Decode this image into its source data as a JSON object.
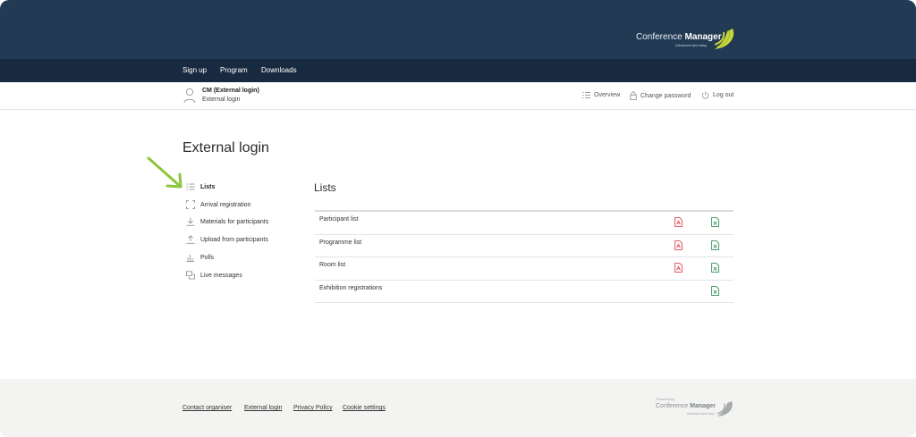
{
  "brand": {
    "name_light": "Conference ",
    "name_bold": "Manager",
    "tagline": "Advanced and easy",
    "logo_color": "#c7d63b"
  },
  "nav": {
    "items": [
      {
        "label": "Sign up"
      },
      {
        "label": "Program"
      },
      {
        "label": "Downloads"
      }
    ]
  },
  "user": {
    "name": "CM (External login)",
    "subtitle": "External login",
    "links": {
      "overview": "Overview",
      "change_password": "Change password",
      "logout": "Log out"
    }
  },
  "page": {
    "title": "External login"
  },
  "sidebar": {
    "items": [
      {
        "label": "Lists",
        "icon": "list-icon",
        "active": true
      },
      {
        "label": "Arrival registration",
        "icon": "scan-icon"
      },
      {
        "label": "Materials for participants",
        "icon": "download-icon"
      },
      {
        "label": "Upload from participants",
        "icon": "upload-icon"
      },
      {
        "label": "Polls",
        "icon": "bar-chart-icon"
      },
      {
        "label": "Live messages",
        "icon": "chat-icon"
      }
    ],
    "highlight_arrow_color": "#8dc63f"
  },
  "lists": {
    "title": "Lists",
    "rows": [
      {
        "label": "Participant list",
        "pdf": true,
        "excel": true
      },
      {
        "label": "Programme list",
        "pdf": true,
        "excel": true
      },
      {
        "label": "Room list",
        "pdf": true,
        "excel": true
      },
      {
        "label": "Exhibition registrations",
        "pdf": false,
        "excel": true
      }
    ],
    "pdf_color": "#e0454c",
    "excel_color": "#2e8b57"
  },
  "footer": {
    "links": [
      {
        "label": "Contact organiser"
      },
      {
        "label": "External login"
      },
      {
        "label": "Privacy Policy"
      },
      {
        "label": "Cookie settings"
      }
    ],
    "powered_by": "Powered by",
    "powered_name_light": "Conference ",
    "powered_name_bold": "Manager",
    "powered_tagline": "Advanced and easy"
  },
  "colors": {
    "topbar": "#233a55",
    "navbar": "#182a3f",
    "footer": "#f3f4f1"
  }
}
